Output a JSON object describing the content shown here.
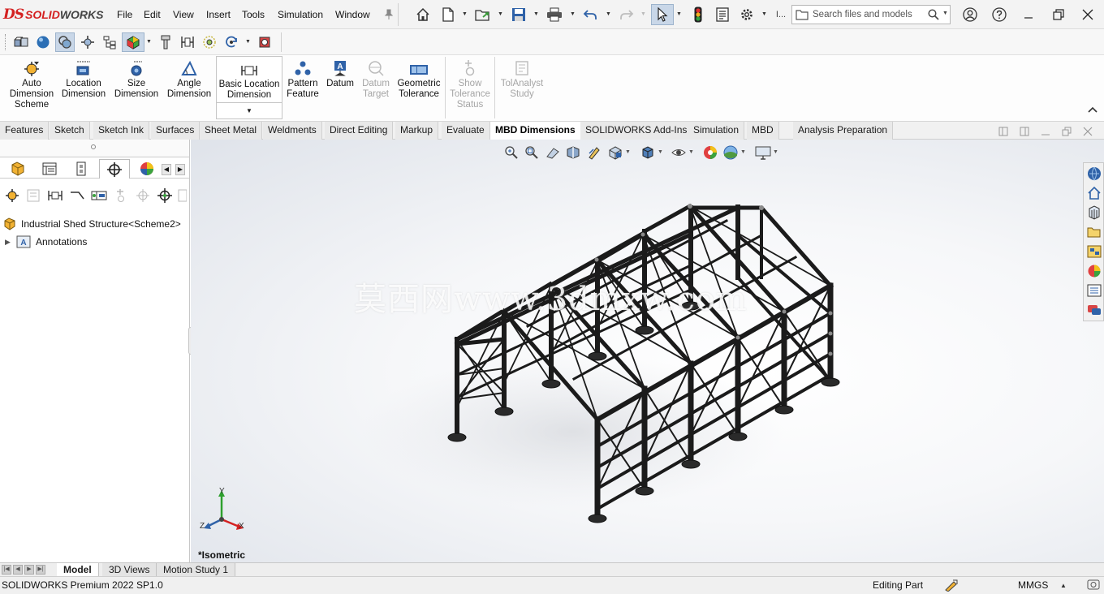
{
  "app": {
    "logo_ds": "DS",
    "logo_solid": "SOLID",
    "logo_works": "WORKS"
  },
  "menu": [
    "File",
    "Edit",
    "View",
    "Insert",
    "Tools",
    "Simulation",
    "Window"
  ],
  "search": {
    "placeholder": "Search files and models"
  },
  "command_manager": {
    "auto_dimension": "Auto Dimension Scheme",
    "location_dimension": "Location Dimension",
    "size_dimension": "Size Dimension",
    "angle_dimension": "Angle Dimension",
    "basic_location_dimension": "Basic Location Dimension",
    "pattern_feature": "Pattern Feature",
    "datum": "Datum",
    "datum_target": "Datum Target",
    "geometric_tolerance": "Geometric Tolerance",
    "show_tolerance_status": "Show Tolerance Status",
    "tolanalyst_study": "TolAnalyst Study"
  },
  "tabs": [
    "Features",
    "Sketch",
    "Sketch Ink",
    "Surfaces",
    "Sheet Metal",
    "Weldments",
    "Direct Editing",
    "Markup",
    "Evaluate",
    "MBD Dimensions",
    "SOLIDWORKS Add-Ins",
    "Simulation",
    "MBD",
    "Analysis Preparation"
  ],
  "active_tab": "MBD Dimensions",
  "tree": {
    "root": "Industrial Shed Structure<Scheme2>",
    "annotations": "Annotations"
  },
  "viewport": {
    "view_name": "*Isometric",
    "watermark": "莫西网www.3dmxw.com",
    "triad": {
      "x": "X",
      "y": "Y",
      "z": "Z"
    }
  },
  "bottom_tabs": [
    "Model",
    "3D Views",
    "Motion Study 1"
  ],
  "status": {
    "version": "SOLIDWORKS Premium 2022 SP1.0",
    "mode": "Editing Part",
    "units": "MMGS"
  },
  "colors": {
    "brand_red": "#d42121",
    "active_button": "#c9d7e8",
    "steel": "#1b1b1b"
  }
}
